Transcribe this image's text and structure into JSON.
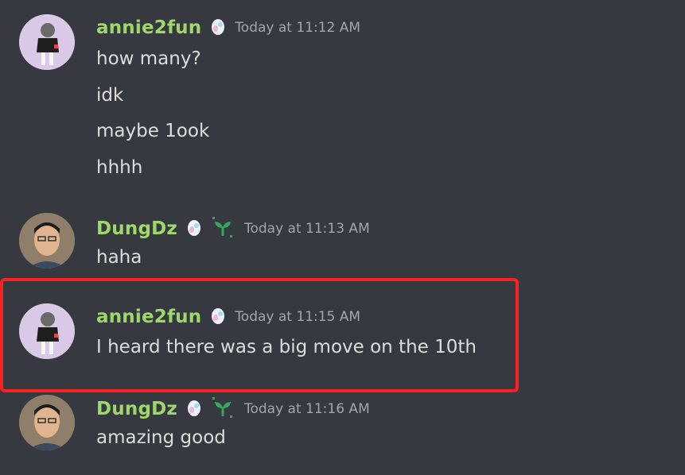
{
  "messages": [
    {
      "username": "annie2fun",
      "timestamp": "Today at 11:12 AM",
      "lines": [
        "how many?",
        "idk",
        "maybe 1ook",
        "hhhh"
      ]
    },
    {
      "username": "DungDz",
      "timestamp": "Today at 11:13 AM",
      "lines": [
        "haha"
      ]
    },
    {
      "username": "annie2fun",
      "timestamp": "Today at 11:15 AM",
      "lines": [
        "I heard there was a big move on the 10th"
      ]
    },
    {
      "username": "DungDz",
      "timestamp": "Today at 11:16 AM",
      "lines": [
        "amazing good"
      ]
    }
  ],
  "colors": {
    "background": "#36393f",
    "username": "#9ed86a",
    "timestamp": "#a3a6aa",
    "message_text": "#dcddde",
    "highlight_border": "#ff2020"
  },
  "icons": [
    "egg-badge-icon",
    "sprout-badge-icon"
  ]
}
